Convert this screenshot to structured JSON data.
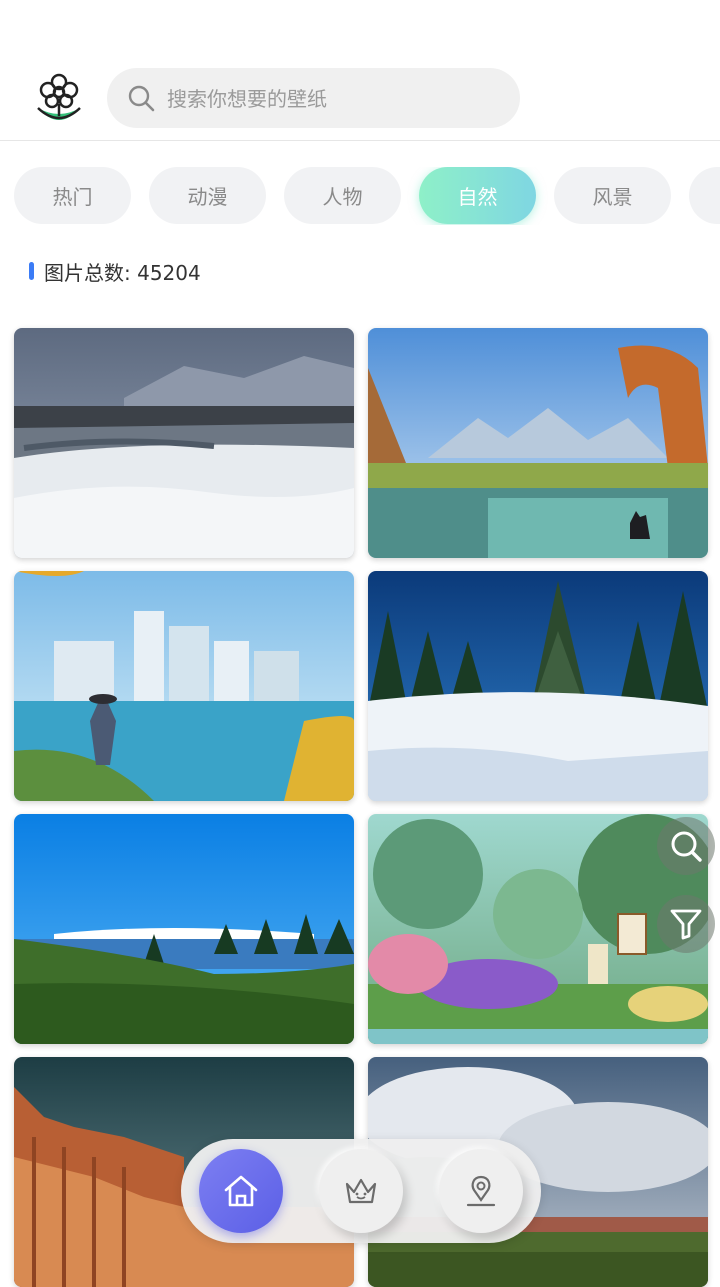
{
  "header": {
    "logo_icon": "flower-logo-icon",
    "search": {
      "placeholder": "搜索你想要的壁纸",
      "value": "",
      "icon": "search-icon"
    }
  },
  "categories": [
    {
      "label": "热门",
      "active": false
    },
    {
      "label": "动漫",
      "active": false
    },
    {
      "label": "人物",
      "active": false
    },
    {
      "label": "自然",
      "active": true
    },
    {
      "label": "风景",
      "active": false
    }
  ],
  "count": {
    "text": "图片总数: 45204"
  },
  "wallpapers": [
    {
      "subject": "snowy-river-mountains"
    },
    {
      "subject": "fantasy-waterfall-arch-wolf"
    },
    {
      "subject": "anime-floating-city-lake"
    },
    {
      "subject": "snow-pine-trees"
    },
    {
      "subject": "green-hill-blue-sky"
    },
    {
      "subject": "painter-in-flower-garden"
    },
    {
      "subject": "red-rock-canyon-storm"
    },
    {
      "subject": "cloudy-sky-meadow"
    }
  ],
  "floating_buttons": [
    {
      "icon": "search-icon"
    },
    {
      "icon": "filter-icon"
    }
  ],
  "bottom_nav": [
    {
      "icon": "home-icon",
      "active": true
    },
    {
      "icon": "crown-icon",
      "active": false
    },
    {
      "icon": "profile-icon",
      "active": false
    }
  ],
  "colors": {
    "accent": "#5b5fe6",
    "tab_active": "#8ef0c8",
    "count_bar": "#3b7cf6"
  }
}
